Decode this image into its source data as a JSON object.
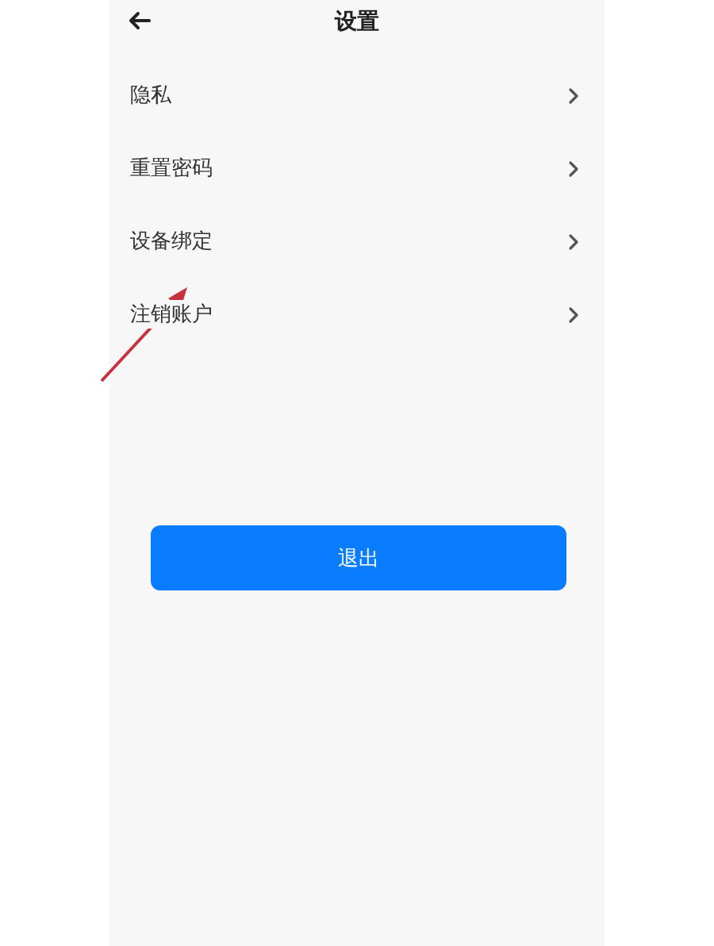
{
  "header": {
    "title": "设置"
  },
  "menu_items": [
    {
      "label": "隐私"
    },
    {
      "label": "重置密码"
    },
    {
      "label": "设备绑定"
    },
    {
      "label": "注销账户"
    }
  ],
  "logout_button": {
    "label": "退出"
  }
}
